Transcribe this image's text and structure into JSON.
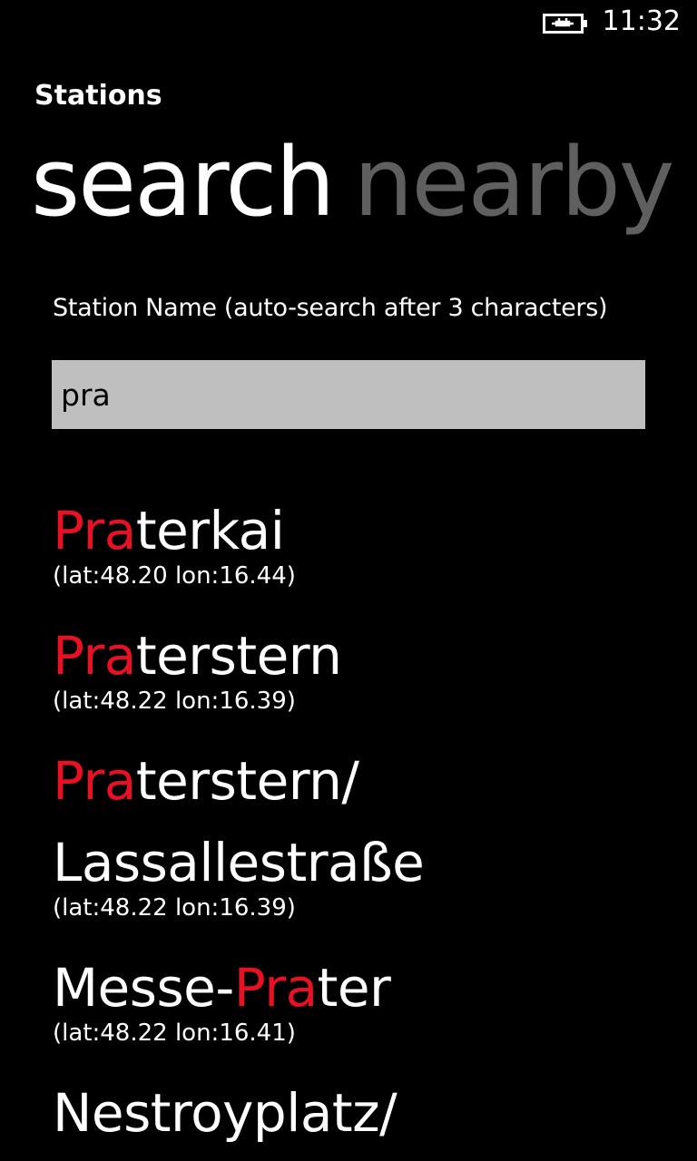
{
  "status_bar": {
    "icons": [
      "battery-charging-icon"
    ],
    "time": "11:32"
  },
  "app": {
    "title": "Stations"
  },
  "pivot": {
    "items": [
      {
        "label": "search",
        "active": true
      },
      {
        "label": "nearby",
        "active": false
      }
    ]
  },
  "search": {
    "label": "Station Name (auto-search after 3 characters)",
    "value": "pra",
    "highlight_color": "#e81123"
  },
  "results": [
    {
      "pre": "",
      "match": "Pra",
      "post": "terkai",
      "coords": "(lat:48.20 lon:16.44)"
    },
    {
      "pre": "",
      "match": "Pra",
      "post": "terstern",
      "coords": "(lat:48.22 lon:16.39)"
    },
    {
      "pre": "",
      "match": "Pra",
      "post": "terstern/ Lassallestraße",
      "coords": "(lat:48.22 lon:16.39)"
    },
    {
      "pre": "Messe-",
      "match": "Pra",
      "post": "ter",
      "coords": "(lat:48.22 lon:16.41)"
    },
    {
      "pre": "Nestroyplatz/",
      "match": "",
      "post": "",
      "coords": ""
    }
  ]
}
